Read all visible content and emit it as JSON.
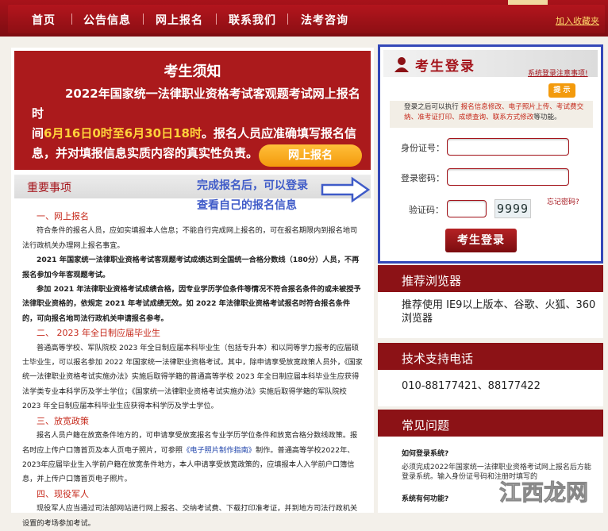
{
  "nav": {
    "items": [
      "首页",
      "公告信息",
      "网上报名",
      "联系我们",
      "法考咨询"
    ],
    "favorite": "加入收藏夹"
  },
  "notice": {
    "title": "考生须知",
    "line1": "2022年国家统一法律职业资格考试客观题考试网上报名时",
    "line2_pre": "间",
    "line2_hl": "6月16日0时至6月30日18时",
    "line2_post": "。报名人员应准确填写报名信",
    "line3": "息，并对填报信息实质内容的真实性负责。",
    "button": "网上报名"
  },
  "important": {
    "title": "重要事项"
  },
  "annotation": {
    "line1": "完成报名后，可以登录",
    "line2": "查看自己的报名信息"
  },
  "content": {
    "s1": "一、网上报名",
    "p1": "符合条件的报名人员，应如实填报本人信息；不能自行完成网上报名的，可在报名期限内到报名地司法行政机关办理网上报名事宜。",
    "p2": "2021 年国家统一法律职业资格考试客观题考试成绩达到全国统一合格分数线（180分）人员，不再报名参加今年客观题考试。",
    "p3": "参加 2021 年法律职业资格考试成绩合格，因专业学历学位条件等情况不符合报名条件的或未被授予法律职业资格的，依规定 2021 年考试成绩无效。如 2022 年法律职业资格考试报名时符合报名条件的，可向报名地司法行政机关申请报名参考。",
    "s2": "二、 2023 年全日制应届毕业生",
    "p4": "普通高等学校、军队院校 2023 年全日制应届本科毕业生（包括专升本）和以同等学力报考的应届硕士毕业生，可以报名参加 2022 年国家统一法律职业资格考试。其中，除申请享受放宽政策人员外，《国家统一法律职业资格考试实施办法》实施后取得学籍的普通高等学校 2023 年全日制应届本科毕业生应获得法学类专业本科学历及学士学位；《国家统一法律职业资格考试实施办法》实施后取得学籍的军队院校 2023 年全日制应届本科毕业生应获得本科学历及学士学位。",
    "s3": "三、放宽政策",
    "p5_pre": "报名人员户籍在放宽条件地方的，可申请享受放宽报名专业学历学位条件和放宽合格分数线政策。报名时应上传户口簿首页及本人页电子照片，可参照",
    "p5_link": "《电子照片制作指南》",
    "p5_post": "制作。普通高等学校2022年、2023年应届毕业生入学前户籍在放宽条件地方，本人申请享受放宽政策的，应填报本人入学前户口簿信息，并上传户口簿首页电子照片。",
    "s4": "四、现役军人",
    "p6": "现役军人应当通过司法部网站进行网上报名、交纳考试费、下载打印准考证，并到地方司法行政机关设置的考场参加考试。"
  },
  "login": {
    "title": "考生登录",
    "note": "系统登录注意事项!",
    "tip_badge": "提 示",
    "tip_pre": "登录之后可以执行 ",
    "tip_links": "报名信息修改、电子照片上传、考试费交纳、准考证打印、成绩查询、联系方式修改",
    "tip_post": "等功能。",
    "id_label": "身份证号：",
    "pwd_label": "登录密码：",
    "code_label": "验证码：",
    "forgot": "忘记密码?",
    "captcha": "9999",
    "button": "考生登录"
  },
  "browser": {
    "title": "推荐浏览器",
    "text": "推荐使用 IE9以上版本、谷歌、火狐、360浏览器"
  },
  "support": {
    "title": "技术支持电话",
    "phone": "010-88177421、88177422"
  },
  "faq": {
    "title": "常见问题",
    "q1": "如何登录系统?",
    "a1": "必须完成2022年国家统一法律职业资格考试网上报名后方能登录系统。输入身份证号码和注册时填写的",
    "q2": "系统有何功能?"
  },
  "watermark": "江西龙网",
  "colors": {
    "primary": "#a4131a",
    "nav": "#8d0f14",
    "highlight": "#ffd23a",
    "button": "#f39a0c",
    "annotation": "#3f5bc8"
  }
}
